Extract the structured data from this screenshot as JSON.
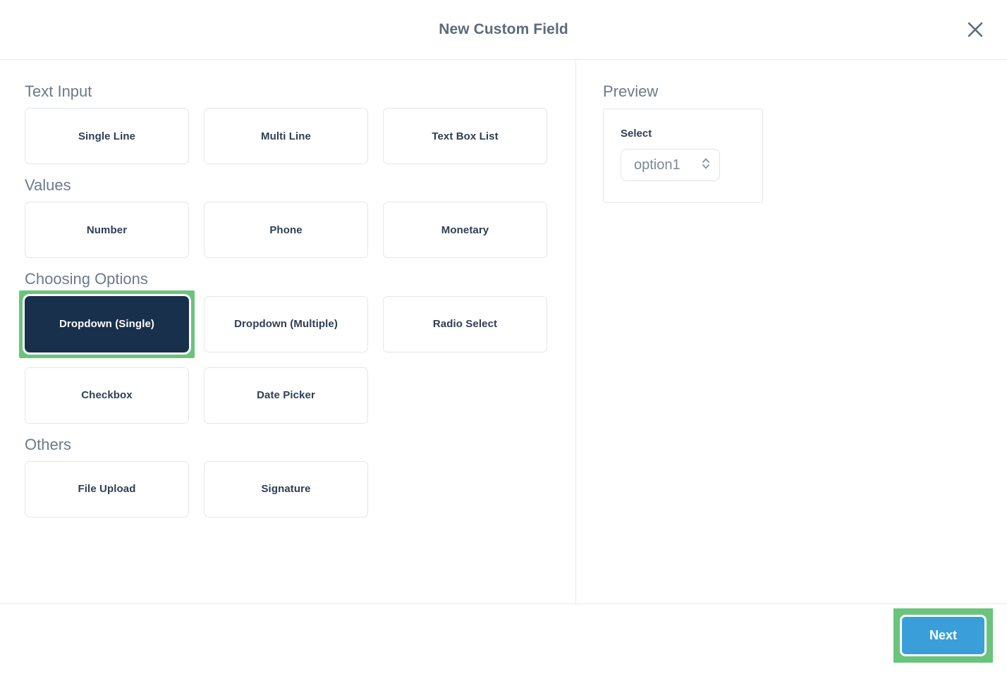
{
  "header": {
    "title": "New Custom Field",
    "close_icon": "close-icon"
  },
  "left_pane": {
    "sections": [
      {
        "label": "Text Input",
        "options": [
          {
            "label": "Single Line",
            "selected": false
          },
          {
            "label": "Multi Line",
            "selected": false
          },
          {
            "label": "Text Box List",
            "selected": false
          }
        ]
      },
      {
        "label": "Values",
        "options": [
          {
            "label": "Number",
            "selected": false
          },
          {
            "label": "Phone",
            "selected": false
          },
          {
            "label": "Monetary",
            "selected": false
          }
        ]
      },
      {
        "label": "Choosing Options",
        "options": [
          {
            "label": "Dropdown (Single)",
            "selected": true
          },
          {
            "label": "Dropdown (Multiple)",
            "selected": false
          },
          {
            "label": "Radio Select",
            "selected": false
          },
          {
            "label": "Checkbox",
            "selected": false
          },
          {
            "label": "Date Picker",
            "selected": false
          }
        ]
      },
      {
        "label": "Others",
        "options": [
          {
            "label": "File Upload",
            "selected": false
          },
          {
            "label": "Signature",
            "selected": false
          }
        ]
      }
    ]
  },
  "right_pane": {
    "preview_label": "Preview",
    "field_label": "Select",
    "select_value": "option1",
    "stepper_icon": "select-stepper-icon"
  },
  "footer": {
    "next_label": "Next"
  },
  "colors": {
    "highlight_green": "#6ac47c",
    "primary_blue": "#3a9fd8",
    "selected_navy": "#18304b",
    "muted_text": "#6c7a89",
    "label_text": "#2f3e53",
    "border": "#e3e7ec"
  }
}
